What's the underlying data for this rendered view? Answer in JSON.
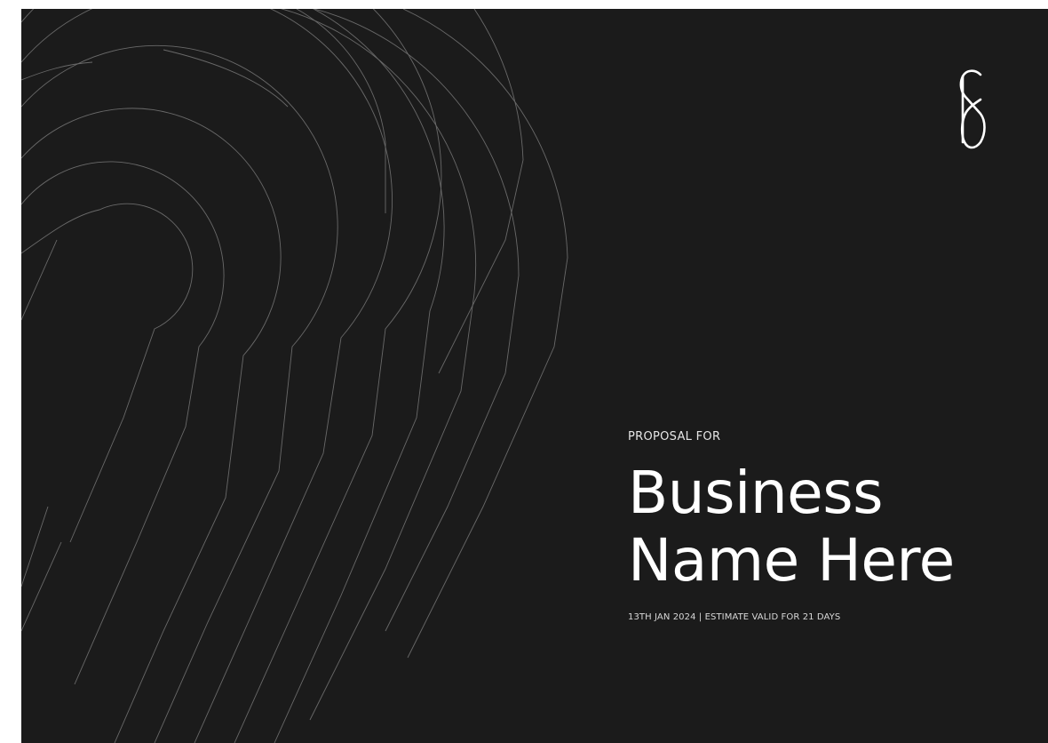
{
  "proposal": {
    "eyebrow": "PROPOSAL FOR",
    "title_line1": "Business",
    "title_line2": "Name Here",
    "meta": "13TH JAN 2024 | ESTIMATE VALID FOR 21 DAYS"
  },
  "logo": {
    "icon": "monogram-logo-icon"
  },
  "colors": {
    "background": "#1b1b1b",
    "text": "#ffffff",
    "lines": "#8a8a8a"
  }
}
